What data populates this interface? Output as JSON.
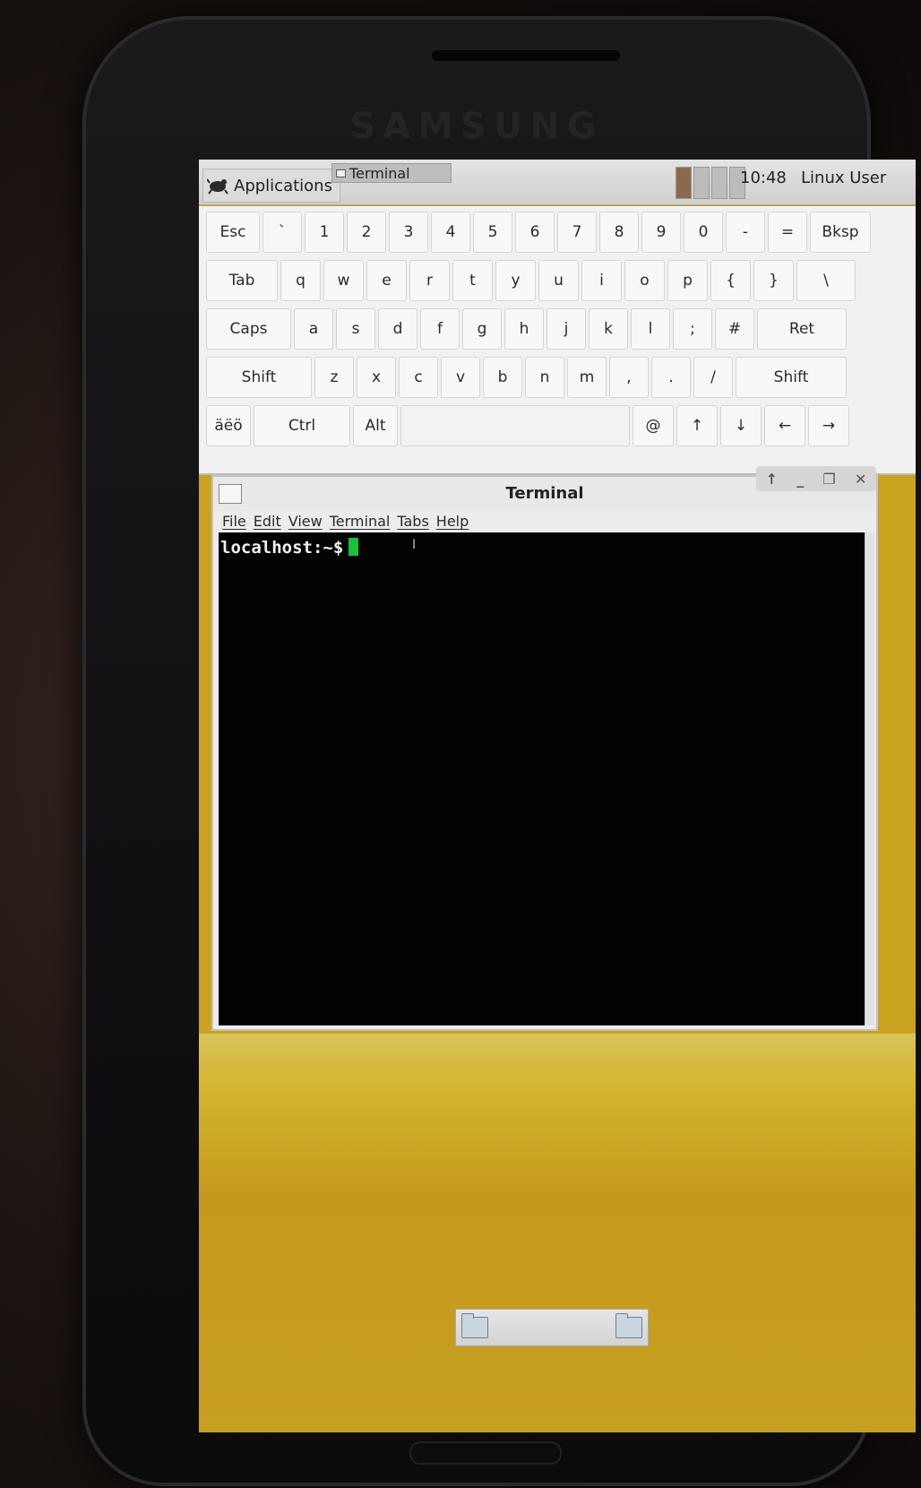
{
  "device": {
    "brand": "SAMSUNG"
  },
  "panel": {
    "applications_label": "Applications",
    "task_label": "Terminal",
    "clock": "10:48",
    "user": "Linux User"
  },
  "keyboard": {
    "row1": [
      "Esc",
      "`",
      "1",
      "2",
      "3",
      "4",
      "5",
      "6",
      "7",
      "8",
      "9",
      "0",
      "-",
      "=",
      "Bksp"
    ],
    "row2": [
      "Tab",
      "q",
      "w",
      "e",
      "r",
      "t",
      "y",
      "u",
      "i",
      "o",
      "p",
      "{",
      "}",
      "\\"
    ],
    "row3": [
      "Caps",
      "a",
      "s",
      "d",
      "f",
      "g",
      "h",
      "j",
      "k",
      "l",
      ";",
      "#",
      "Ret"
    ],
    "row4": [
      "Shift",
      "z",
      "x",
      "c",
      "v",
      "b",
      "n",
      "m",
      ",",
      ".",
      "/",
      "Shift"
    ],
    "row5": [
      "äëö",
      "Ctrl",
      "Alt",
      "",
      "@",
      "↑",
      "↓",
      "←",
      "→"
    ]
  },
  "terminal": {
    "title": "Terminal",
    "menu": [
      "File",
      "Edit",
      "View",
      "Terminal",
      "Tabs",
      "Help"
    ],
    "prompt": "localhost:~$",
    "controls": [
      "↑",
      "_",
      "❐",
      "✕"
    ]
  }
}
